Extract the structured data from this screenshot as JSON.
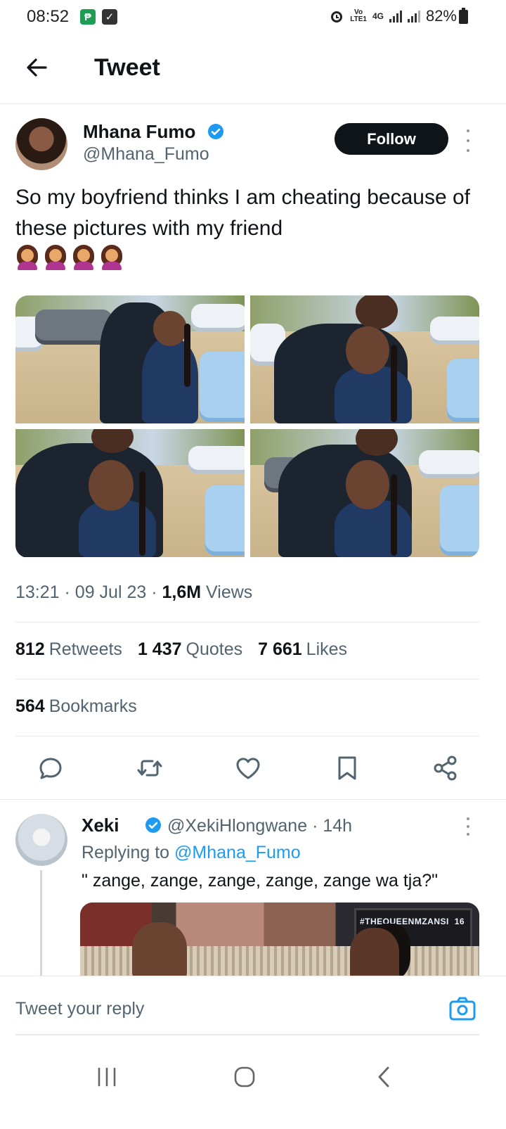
{
  "status_bar": {
    "time": "08:52",
    "left_icons": [
      "p-app-icon",
      "checkbox-icon"
    ],
    "network_top": "Vo",
    "network_bottom": "LTE1",
    "network_type": "4G",
    "battery": "82%"
  },
  "header": {
    "title": "Tweet",
    "back_icon": "back-arrow-icon"
  },
  "tweet": {
    "author_name": "Mhana Fumo",
    "author_handle": "@Mhana_Fumo",
    "follow_label": "Follow",
    "text": "So my boyfriend thinks I am cheating because of these pictures with my friend",
    "emojis": [
      "woman-shrugging-emoji",
      "woman-shrugging-emoji",
      "woman-shrugging-emoji",
      "woman-shrugging-emoji"
    ],
    "time": "13:21",
    "date": "09 Jul 23",
    "views_count": "1,6M",
    "views_label": "Views",
    "retweets_count": "812",
    "retweets_label": "Retweets",
    "quotes_count": "1 437",
    "quotes_label": "Quotes",
    "likes_count": "7 661",
    "likes_label": "Likes",
    "bookmarks_count": "564",
    "bookmarks_label": "Bookmarks",
    "photo_count": 4
  },
  "actions": [
    "reply-icon",
    "retweet-icon",
    "like-icon",
    "bookmark-icon",
    "share-icon"
  ],
  "reply": {
    "name": "Xeki",
    "handle": "@XekiHlongwane",
    "age": "14h",
    "replying_prefix": "Replying to",
    "replying_to": "@Mhana_Fumo",
    "text": "\" zange, zange, zange, zange, zange wa tja?\"",
    "media_label": "#THEQUEENMZANSI",
    "media_badge": "16"
  },
  "composer": {
    "placeholder": "Tweet your reply"
  },
  "colors": {
    "accent": "#1d9bf0",
    "text_primary": "#0f1419",
    "text_secondary": "#536471",
    "follow_bg": "#0f1419"
  }
}
